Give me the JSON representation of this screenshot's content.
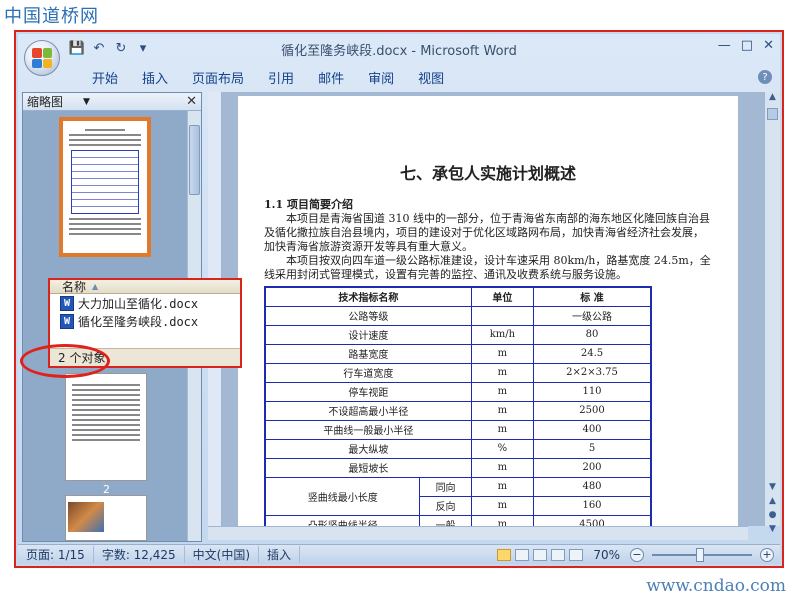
{
  "watermark": {
    "top": "中国道桥网",
    "bottom": "www.cndao.com"
  },
  "window": {
    "title": "循化至隆务峡段.docx - Microsoft Word"
  },
  "ribbon": {
    "tabs": [
      "开始",
      "插入",
      "页面布局",
      "引用",
      "邮件",
      "审阅",
      "视图"
    ]
  },
  "thumbnail_pane": {
    "title": "缩略图",
    "page_label": "2"
  },
  "popup": {
    "header": "名称",
    "files": [
      "大力加山至循化.docx",
      "循化至隆务峡段.docx"
    ],
    "footer": "2 个对象"
  },
  "document": {
    "title": "七、承包人实施计划概述",
    "section": "1.1 项目简要介绍",
    "para1": "本项目是青海省国道 310 线中的一部分，位于青海省东南部的海东地区化隆回族自治县及循化撒拉族自治县境内，项目的建设对于优化区域路网布局，加快青海省经济社会发展，加快青海省旅游资源开发等具有重大意义。",
    "para2": "本项目按双向四车道一级公路标准建设，设计车速采用 80km/h，路基宽度 24.5m，全线采用封闭式管理模式，设置有完善的监控、通讯及收费系统与服务设施。",
    "table": {
      "headers": [
        "技术指标名称",
        "单位",
        "标 准"
      ],
      "rows": [
        [
          "公路等级",
          "",
          "一级公路"
        ],
        [
          "设计速度",
          "km/h",
          "80"
        ],
        [
          "路基宽度",
          "m",
          "24.5"
        ],
        [
          "行车道宽度",
          "m",
          "2×2×3.75"
        ],
        [
          "停车视距",
          "m",
          "110"
        ],
        [
          "不设超高最小半径",
          "m",
          "2500"
        ],
        [
          "平曲线一般最小半径",
          "m",
          "400"
        ],
        [
          "最大纵坡",
          "%",
          "5"
        ],
        [
          "最短坡长",
          "m",
          "200"
        ]
      ],
      "merged_label": "竖曲线最小长度",
      "merged_rows": [
        [
          "同向",
          "m",
          "480"
        ],
        [
          "反向",
          "m",
          "160"
        ]
      ],
      "last_row": [
        "凸形竖曲线半径",
        "一般",
        "m",
        "4500"
      ]
    }
  },
  "status": {
    "page": "页面: 1/15",
    "words": "字数: 12,425",
    "language": "中文(中国)",
    "mode": "插入",
    "zoom": "70%"
  }
}
